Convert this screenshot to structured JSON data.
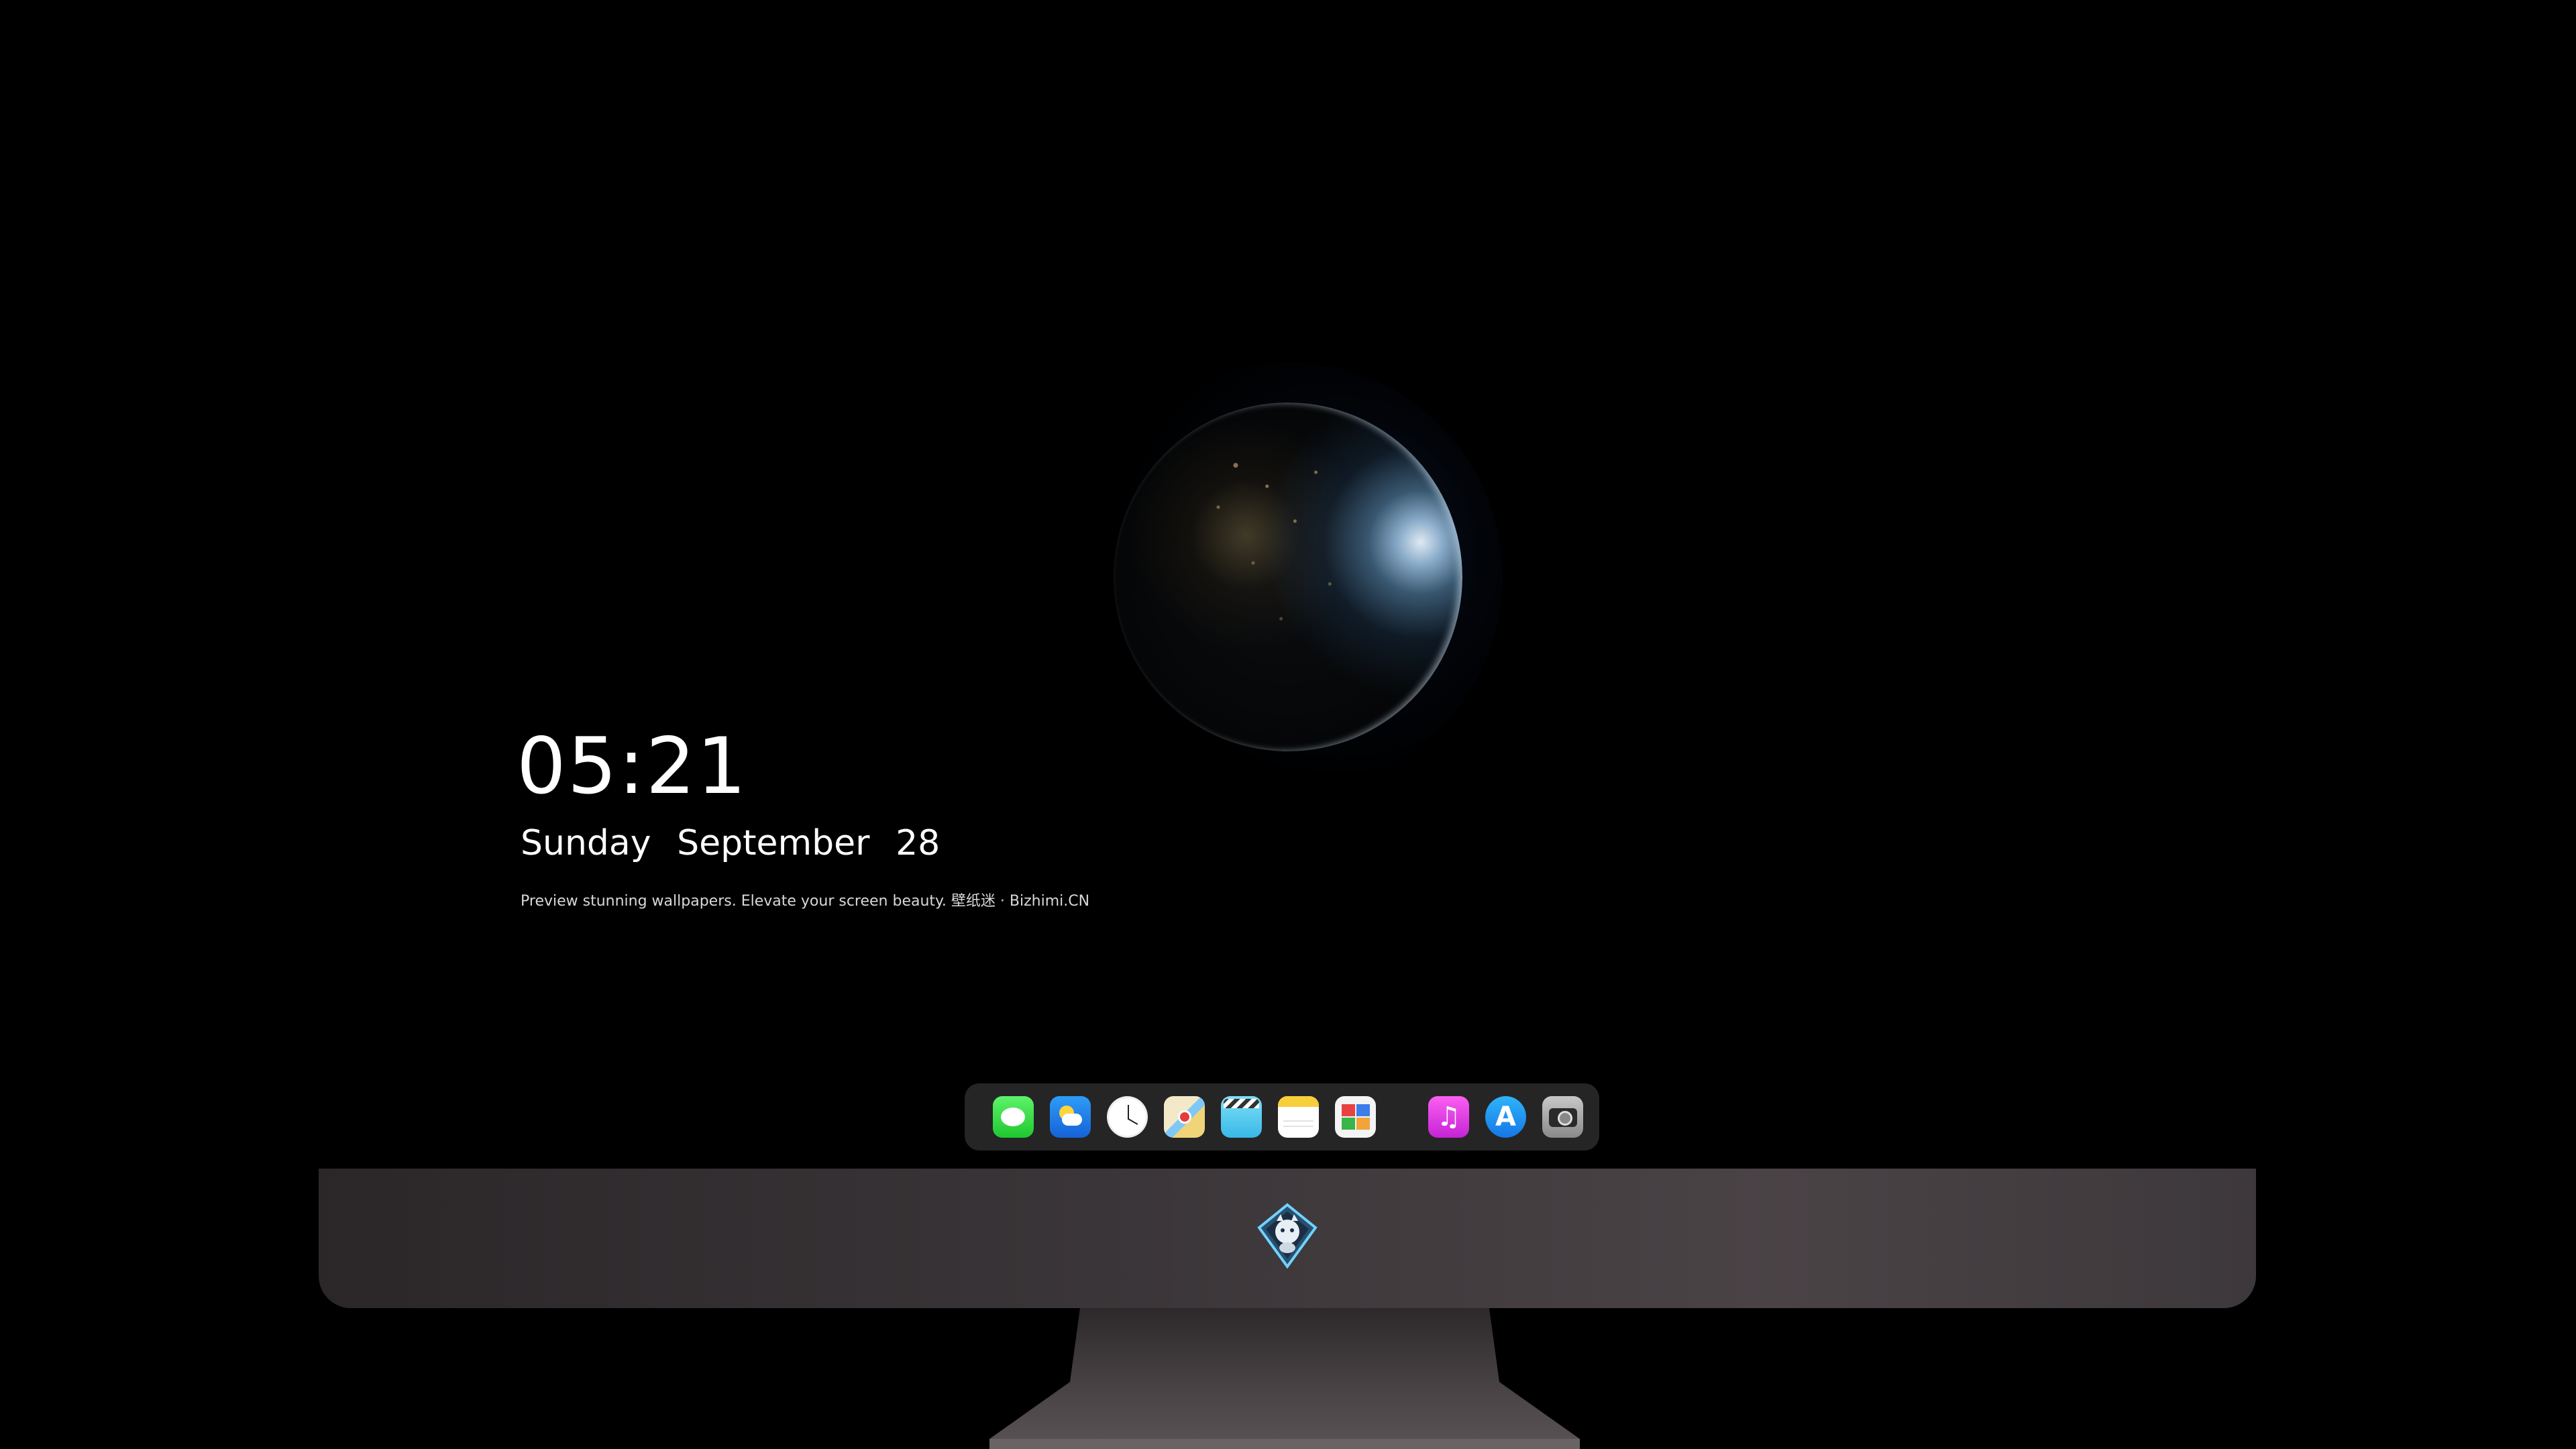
{
  "clock": {
    "time": "05:21",
    "weekday": "Sunday",
    "month": "September",
    "day": "28",
    "tagline": "Preview stunning wallpapers. Elevate your screen beauty. 壁纸迷 · Bizhimi.CN"
  },
  "dock": {
    "items": [
      {
        "name": "Messages",
        "icon": "messages-icon"
      },
      {
        "name": "Weather",
        "icon": "weather-icon"
      },
      {
        "name": "Clock",
        "icon": "clock-icon"
      },
      {
        "name": "Maps",
        "icon": "maps-icon"
      },
      {
        "name": "Clips",
        "icon": "clips-icon"
      },
      {
        "name": "Notes",
        "icon": "notes-icon"
      },
      {
        "name": "Calendar",
        "icon": "calendar-icon"
      },
      {
        "name": "Music",
        "icon": "music-icon"
      },
      {
        "name": "App Store",
        "icon": "app-store-icon"
      },
      {
        "name": "Camera",
        "icon": "camera-icon"
      }
    ]
  },
  "chin": {
    "logo": "dragon-mascot-logo"
  },
  "colors": {
    "background": "#000000",
    "dock": "#282828",
    "chin": "#3a3538",
    "text": "#ffffff"
  }
}
